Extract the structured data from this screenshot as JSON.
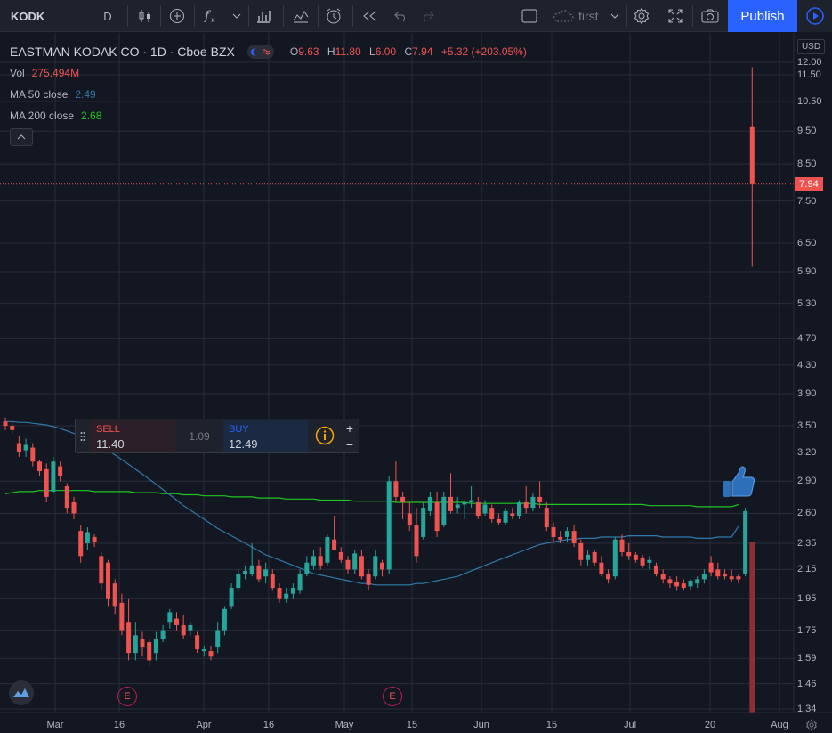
{
  "toolbar": {
    "symbol": "KODK",
    "interval": "D",
    "layout_name": "first",
    "publish_label": "Publish",
    "icons": [
      "candles-icon",
      "add-indicator-icon",
      "fx-icon",
      "chevron-down-icon",
      "bar-chart-icon",
      "templates-icon",
      "alert-clock-icon",
      "replay-icon",
      "undo-icon",
      "redo-icon",
      "fullscreen-box-icon",
      "cloud-icon",
      "gear-icon",
      "expand-icon",
      "camera-icon",
      "play-icon"
    ]
  },
  "legend": {
    "title": "EASTMAN KODAK CO · 1D · Cboe BZX",
    "open_key": "O",
    "open": "9.63",
    "high_key": "H",
    "high": "11.80",
    "low_key": "L",
    "low": "6.00",
    "close_key": "C",
    "close": "7.94",
    "change": "+5.32 (+203.05%)",
    "vol_label": "Vol",
    "vol_value": "275.494M",
    "ma50_label": "MA 50 close",
    "ma50_value": "2.49",
    "ma200_label": "MA 200 close",
    "ma200_value": "2.68"
  },
  "trade": {
    "sell_label": "SELL",
    "sell_price": "11.40",
    "spread": "1.09",
    "buy_label": "BUY",
    "buy_price": "12.49",
    "plus": "+",
    "minus": "−"
  },
  "price_axis": {
    "currency": "USD",
    "last_price": "7.94",
    "labels": [
      "12.00",
      "11.50",
      "10.50",
      "9.50",
      "8.50",
      "7.50",
      "6.50",
      "5.90",
      "5.30",
      "4.70",
      "4.30",
      "3.90",
      "3.50",
      "3.20",
      "2.90",
      "2.60",
      "2.35",
      "2.15",
      "1.95",
      "1.75",
      "1.59",
      "1.46",
      "1.34"
    ]
  },
  "time_axis": {
    "labels": [
      "Mar",
      "16",
      "Apr",
      "16",
      "May",
      "15",
      "Jun",
      "15",
      "Jul",
      "20",
      "Aug"
    ]
  },
  "markers": {
    "earnings_label": "E"
  },
  "colors": {
    "background": "#131722",
    "grid": "#2a2e39",
    "up": "#26a69a",
    "down": "#ef5350",
    "ma50": "#3179a8",
    "ma200": "#21c521",
    "accent": "#2962ff"
  },
  "chart_data": {
    "type": "candlestick",
    "symbol": "KODK",
    "timeframe": "1D",
    "y_scale": "log",
    "ylim": [
      1.34,
      12.0
    ],
    "x_range": [
      "2020-02-26",
      "2020-07-29"
    ],
    "candles": [
      {
        "o": 3.55,
        "h": 3.6,
        "l": 3.45,
        "c": 3.5
      },
      {
        "o": 3.5,
        "h": 3.55,
        "l": 3.4,
        "c": 3.45
      },
      {
        "o": 3.3,
        "h": 3.38,
        "l": 3.15,
        "c": 3.2
      },
      {
        "o": 3.22,
        "h": 3.35,
        "l": 3.15,
        "c": 3.28
      },
      {
        "o": 3.25,
        "h": 3.3,
        "l": 3.05,
        "c": 3.1
      },
      {
        "o": 3.1,
        "h": 3.12,
        "l": 2.95,
        "c": 3.0
      },
      {
        "o": 3.02,
        "h": 3.08,
        "l": 2.7,
        "c": 2.75
      },
      {
        "o": 2.8,
        "h": 3.15,
        "l": 2.78,
        "c": 3.1
      },
      {
        "o": 3.05,
        "h": 3.1,
        "l": 2.9,
        "c": 2.95
      },
      {
        "o": 2.85,
        "h": 2.88,
        "l": 2.6,
        "c": 2.65
      },
      {
        "o": 2.7,
        "h": 2.75,
        "l": 2.55,
        "c": 2.6
      },
      {
        "o": 2.45,
        "h": 2.5,
        "l": 2.2,
        "c": 2.25
      },
      {
        "o": 2.35,
        "h": 2.48,
        "l": 2.3,
        "c": 2.44
      },
      {
        "o": 2.4,
        "h": 2.42,
        "l": 2.32,
        "c": 2.36
      },
      {
        "o": 2.25,
        "h": 2.28,
        "l": 2.0,
        "c": 2.05
      },
      {
        "o": 2.2,
        "h": 2.22,
        "l": 1.9,
        "c": 1.95
      },
      {
        "o": 2.05,
        "h": 2.08,
        "l": 1.85,
        "c": 1.9
      },
      {
        "o": 1.92,
        "h": 1.98,
        "l": 1.72,
        "c": 1.75
      },
      {
        "o": 1.8,
        "h": 1.95,
        "l": 1.58,
        "c": 1.62
      },
      {
        "o": 1.62,
        "h": 1.8,
        "l": 1.58,
        "c": 1.72
      },
      {
        "o": 1.7,
        "h": 1.74,
        "l": 1.6,
        "c": 1.65
      },
      {
        "o": 1.68,
        "h": 1.7,
        "l": 1.55,
        "c": 1.58
      },
      {
        "o": 1.62,
        "h": 1.74,
        "l": 1.58,
        "c": 1.7
      },
      {
        "o": 1.7,
        "h": 1.78,
        "l": 1.68,
        "c": 1.75
      },
      {
        "o": 1.8,
        "h": 1.88,
        "l": 1.76,
        "c": 1.86
      },
      {
        "o": 1.82,
        "h": 1.86,
        "l": 1.75,
        "c": 1.78
      },
      {
        "o": 1.78,
        "h": 1.84,
        "l": 1.7,
        "c": 1.72
      },
      {
        "o": 1.75,
        "h": 1.8,
        "l": 1.72,
        "c": 1.78
      },
      {
        "o": 1.72,
        "h": 1.74,
        "l": 1.62,
        "c": 1.64
      },
      {
        "o": 1.63,
        "h": 1.66,
        "l": 1.6,
        "c": 1.64
      },
      {
        "o": 1.63,
        "h": 1.66,
        "l": 1.58,
        "c": 1.6
      },
      {
        "o": 1.65,
        "h": 1.8,
        "l": 1.62,
        "c": 1.75
      },
      {
        "o": 1.75,
        "h": 1.9,
        "l": 1.72,
        "c": 1.88
      },
      {
        "o": 1.9,
        "h": 2.05,
        "l": 1.88,
        "c": 2.02
      },
      {
        "o": 2.02,
        "h": 2.15,
        "l": 2.0,
        "c": 2.12
      },
      {
        "o": 2.12,
        "h": 2.18,
        "l": 2.08,
        "c": 2.14
      },
      {
        "o": 2.12,
        "h": 2.35,
        "l": 2.1,
        "c": 2.18
      },
      {
        "o": 2.18,
        "h": 2.22,
        "l": 2.06,
        "c": 2.08
      },
      {
        "o": 2.1,
        "h": 2.2,
        "l": 2.05,
        "c": 2.15
      },
      {
        "o": 2.12,
        "h": 2.15,
        "l": 2.0,
        "c": 2.02
      },
      {
        "o": 2.02,
        "h": 2.05,
        "l": 1.92,
        "c": 1.95
      },
      {
        "o": 1.95,
        "h": 2.02,
        "l": 1.92,
        "c": 1.98
      },
      {
        "o": 1.98,
        "h": 2.05,
        "l": 1.95,
        "c": 2.02
      },
      {
        "o": 2.0,
        "h": 2.15,
        "l": 1.98,
        "c": 2.12
      },
      {
        "o": 2.12,
        "h": 2.25,
        "l": 2.1,
        "c": 2.2
      },
      {
        "o": 2.18,
        "h": 2.3,
        "l": 2.15,
        "c": 2.25
      },
      {
        "o": 2.25,
        "h": 2.32,
        "l": 2.15,
        "c": 2.18
      },
      {
        "o": 2.2,
        "h": 2.42,
        "l": 2.18,
        "c": 2.4
      },
      {
        "o": 2.38,
        "h": 2.58,
        "l": 2.35,
        "c": 2.3
      },
      {
        "o": 2.28,
        "h": 2.32,
        "l": 2.2,
        "c": 2.22
      },
      {
        "o": 2.22,
        "h": 2.25,
        "l": 2.12,
        "c": 2.15
      },
      {
        "o": 2.15,
        "h": 2.3,
        "l": 2.12,
        "c": 2.27
      },
      {
        "o": 2.25,
        "h": 2.3,
        "l": 2.08,
        "c": 2.1
      },
      {
        "o": 2.12,
        "h": 2.15,
        "l": 2.0,
        "c": 2.04
      },
      {
        "o": 2.1,
        "h": 2.3,
        "l": 2.08,
        "c": 2.25
      },
      {
        "o": 2.2,
        "h": 2.22,
        "l": 2.1,
        "c": 2.15
      },
      {
        "o": 2.15,
        "h": 2.95,
        "l": 2.12,
        "c": 2.9
      },
      {
        "o": 2.9,
        "h": 3.1,
        "l": 2.7,
        "c": 2.75
      },
      {
        "o": 2.75,
        "h": 2.8,
        "l": 2.55,
        "c": 2.7
      },
      {
        "o": 2.6,
        "h": 2.7,
        "l": 2.45,
        "c": 2.5
      },
      {
        "o": 2.5,
        "h": 2.65,
        "l": 2.2,
        "c": 2.25
      },
      {
        "o": 2.4,
        "h": 2.7,
        "l": 2.38,
        "c": 2.65
      },
      {
        "o": 2.62,
        "h": 2.8,
        "l": 2.58,
        "c": 2.75
      },
      {
        "o": 2.7,
        "h": 2.8,
        "l": 2.4,
        "c": 2.45
      },
      {
        "o": 2.5,
        "h": 2.8,
        "l": 2.48,
        "c": 2.75
      },
      {
        "o": 2.75,
        "h": 2.98,
        "l": 2.6,
        "c": 2.62
      },
      {
        "o": 2.65,
        "h": 2.75,
        "l": 2.6,
        "c": 2.68
      },
      {
        "o": 2.68,
        "h": 2.72,
        "l": 2.55,
        "c": 2.7
      },
      {
        "o": 2.7,
        "h": 2.85,
        "l": 2.65,
        "c": 2.72
      },
      {
        "o": 2.7,
        "h": 2.75,
        "l": 2.55,
        "c": 2.58
      },
      {
        "o": 2.6,
        "h": 2.72,
        "l": 2.58,
        "c": 2.68
      },
      {
        "o": 2.65,
        "h": 2.68,
        "l": 2.52,
        "c": 2.55
      },
      {
        "o": 2.55,
        "h": 2.6,
        "l": 2.5,
        "c": 2.52
      },
      {
        "o": 2.52,
        "h": 2.65,
        "l": 2.5,
        "c": 2.62
      },
      {
        "o": 2.6,
        "h": 2.65,
        "l": 2.55,
        "c": 2.58
      },
      {
        "o": 2.58,
        "h": 2.72,
        "l": 2.55,
        "c": 2.7
      },
      {
        "o": 2.7,
        "h": 2.85,
        "l": 2.6,
        "c": 2.65
      },
      {
        "o": 2.65,
        "h": 2.78,
        "l": 2.62,
        "c": 2.75
      },
      {
        "o": 2.75,
        "h": 2.9,
        "l": 2.65,
        "c": 2.7
      },
      {
        "o": 2.65,
        "h": 2.7,
        "l": 2.45,
        "c": 2.48
      },
      {
        "o": 2.48,
        "h": 2.52,
        "l": 2.35,
        "c": 2.4
      },
      {
        "o": 2.4,
        "h": 2.45,
        "l": 2.35,
        "c": 2.38
      },
      {
        "o": 2.4,
        "h": 2.48,
        "l": 2.36,
        "c": 2.45
      },
      {
        "o": 2.45,
        "h": 2.5,
        "l": 2.32,
        "c": 2.35
      },
      {
        "o": 2.35,
        "h": 2.38,
        "l": 2.18,
        "c": 2.22
      },
      {
        "o": 2.22,
        "h": 2.3,
        "l": 2.18,
        "c": 2.26
      },
      {
        "o": 2.28,
        "h": 2.3,
        "l": 2.18,
        "c": 2.2
      },
      {
        "o": 2.2,
        "h": 2.25,
        "l": 2.1,
        "c": 2.12
      },
      {
        "o": 2.12,
        "h": 2.15,
        "l": 2.05,
        "c": 2.08
      },
      {
        "o": 2.1,
        "h": 2.4,
        "l": 2.08,
        "c": 2.38
      },
      {
        "o": 2.38,
        "h": 2.42,
        "l": 2.25,
        "c": 2.28
      },
      {
        "o": 2.28,
        "h": 2.35,
        "l": 2.22,
        "c": 2.25
      },
      {
        "o": 2.26,
        "h": 2.28,
        "l": 2.2,
        "c": 2.22
      },
      {
        "o": 2.24,
        "h": 2.26,
        "l": 2.16,
        "c": 2.18
      },
      {
        "o": 2.2,
        "h": 2.25,
        "l": 2.15,
        "c": 2.22
      },
      {
        "o": 2.18,
        "h": 2.2,
        "l": 2.1,
        "c": 2.12
      },
      {
        "o": 2.12,
        "h": 2.15,
        "l": 2.05,
        "c": 2.08
      },
      {
        "o": 2.08,
        "h": 2.1,
        "l": 2.02,
        "c": 2.05
      },
      {
        "o": 2.06,
        "h": 2.1,
        "l": 2.0,
        "c": 2.03
      },
      {
        "o": 2.05,
        "h": 2.08,
        "l": 2.0,
        "c": 2.02
      },
      {
        "o": 2.03,
        "h": 2.08,
        "l": 2.0,
        "c": 2.07
      },
      {
        "o": 2.05,
        "h": 2.1,
        "l": 2.02,
        "c": 2.08
      },
      {
        "o": 2.08,
        "h": 2.15,
        "l": 2.05,
        "c": 2.12
      },
      {
        "o": 2.2,
        "h": 2.25,
        "l": 2.1,
        "c": 2.13
      },
      {
        "o": 2.15,
        "h": 2.2,
        "l": 2.08,
        "c": 2.1
      },
      {
        "o": 2.12,
        "h": 2.15,
        "l": 2.08,
        "c": 2.1
      },
      {
        "o": 2.1,
        "h": 2.15,
        "l": 2.06,
        "c": 2.08
      },
      {
        "o": 2.1,
        "h": 2.12,
        "l": 2.05,
        "c": 2.08
      },
      {
        "o": 2.12,
        "h": 2.65,
        "l": 2.1,
        "c": 2.62
      },
      {
        "o": 9.63,
        "h": 11.8,
        "l": 6.0,
        "c": 7.94
      }
    ],
    "ma50": [
      3.55,
      3.55,
      3.54,
      3.54,
      3.53,
      3.52,
      3.51,
      3.49,
      3.47,
      3.44,
      3.41,
      3.38,
      3.35,
      3.31,
      3.27,
      3.22,
      3.17,
      3.12,
      3.07,
      3.02,
      2.97,
      2.92,
      2.87,
      2.82,
      2.77,
      2.72,
      2.67,
      2.63,
      2.59,
      2.55,
      2.51,
      2.47,
      2.44,
      2.41,
      2.38,
      2.35,
      2.32,
      2.29,
      2.26,
      2.24,
      2.22,
      2.2,
      2.18,
      2.16,
      2.14,
      2.12,
      2.11,
      2.1,
      2.09,
      2.08,
      2.07,
      2.06,
      2.05,
      2.05,
      2.04,
      2.04,
      2.04,
      2.04,
      2.04,
      2.04,
      2.05,
      2.05,
      2.06,
      2.07,
      2.08,
      2.09,
      2.1,
      2.12,
      2.14,
      2.16,
      2.18,
      2.2,
      2.22,
      2.24,
      2.26,
      2.28,
      2.3,
      2.32,
      2.34,
      2.35,
      2.36,
      2.37,
      2.38,
      2.38,
      2.39,
      2.39,
      2.39,
      2.4,
      2.4,
      2.4,
      2.4,
      2.41,
      2.41,
      2.41,
      2.41,
      2.41,
      2.4,
      2.4,
      2.4,
      2.4,
      2.4,
      2.39,
      2.39,
      2.39,
      2.4,
      2.4,
      2.4,
      2.49
    ],
    "ma200": [
      2.78,
      2.79,
      2.8,
      2.8,
      2.8,
      2.81,
      2.81,
      2.81,
      2.81,
      2.81,
      2.81,
      2.81,
      2.81,
      2.8,
      2.8,
      2.8,
      2.8,
      2.8,
      2.8,
      2.79,
      2.79,
      2.79,
      2.79,
      2.78,
      2.78,
      2.78,
      2.77,
      2.77,
      2.77,
      2.76,
      2.76,
      2.76,
      2.76,
      2.75,
      2.75,
      2.75,
      2.75,
      2.74,
      2.74,
      2.74,
      2.74,
      2.73,
      2.73,
      2.73,
      2.73,
      2.73,
      2.72,
      2.72,
      2.72,
      2.72,
      2.72,
      2.71,
      2.71,
      2.71,
      2.71,
      2.71,
      2.71,
      2.7,
      2.7,
      2.7,
      2.7,
      2.7,
      2.7,
      2.7,
      2.7,
      2.7,
      2.7,
      2.7,
      2.69,
      2.69,
      2.69,
      2.69,
      2.69,
      2.69,
      2.69,
      2.69,
      2.69,
      2.69,
      2.68,
      2.68,
      2.68,
      2.68,
      2.68,
      2.68,
      2.68,
      2.68,
      2.68,
      2.68,
      2.68,
      2.68,
      2.68,
      2.68,
      2.68,
      2.68,
      2.67,
      2.67,
      2.67,
      2.67,
      2.67,
      2.67,
      2.67,
      2.66,
      2.66,
      2.66,
      2.66,
      2.66,
      2.66,
      2.68
    ]
  }
}
